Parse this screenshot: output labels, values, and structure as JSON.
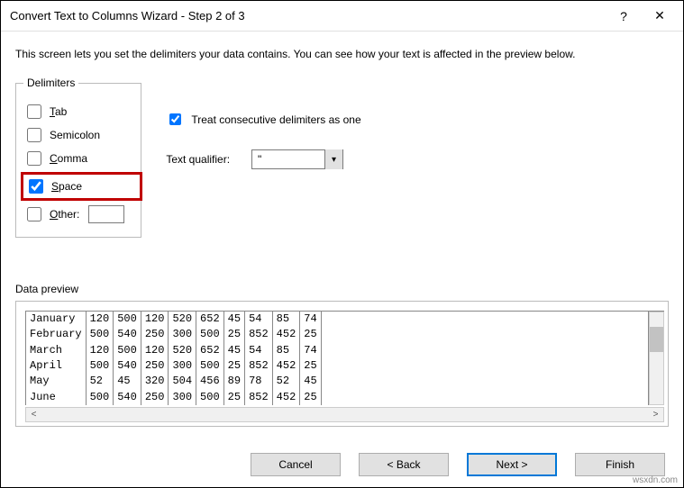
{
  "window": {
    "title": "Convert Text to Columns Wizard - Step 2 of 3",
    "help_icon": "?",
    "close_icon": "✕"
  },
  "description": "This screen lets you set the delimiters your data contains.  You can see how your text is affected in the preview below.",
  "delimiters": {
    "legend": "Delimiters",
    "tab": {
      "checked": false,
      "label_pre": "T",
      "label_post": "ab"
    },
    "semicolon": {
      "checked": false,
      "label_pre": "",
      "label_post": "Semicolon"
    },
    "comma": {
      "checked": false,
      "label_pre": "C",
      "label_post": "omma"
    },
    "space": {
      "checked": true,
      "label_pre": "S",
      "label_post": "pace"
    },
    "other": {
      "checked": false,
      "label_pre": "O",
      "label_post": "ther:",
      "value": ""
    }
  },
  "options": {
    "treat_consecutive": {
      "checked": true,
      "label": "Treat consecutive delimiters as one"
    },
    "qualifier_label": "Text qualifier:",
    "qualifier_value": "\""
  },
  "preview": {
    "legend": "Data preview",
    "rows": [
      [
        "January",
        "120",
        "500",
        "120",
        "520",
        "652",
        "45",
        "54",
        "85",
        "74"
      ],
      [
        "February",
        "500",
        "540",
        "250",
        "300",
        "500",
        "25",
        "852",
        "452",
        "25"
      ],
      [
        "March",
        "120",
        "500",
        "120",
        "520",
        "652",
        "45",
        "54",
        "85",
        "74"
      ],
      [
        "April",
        "500",
        "540",
        "250",
        "300",
        "500",
        "25",
        "852",
        "452",
        "25"
      ],
      [
        "May",
        "52",
        "45",
        "320",
        "504",
        "456",
        "89",
        "78",
        "52",
        "45"
      ],
      [
        "June",
        "500",
        "540",
        "250",
        "300",
        "500",
        "25",
        "852",
        "452",
        "25"
      ]
    ]
  },
  "buttons": {
    "cancel": "Cancel",
    "back": "< Back",
    "next": "Next >",
    "finish": "Finish"
  },
  "watermark": "wsxdn.com"
}
